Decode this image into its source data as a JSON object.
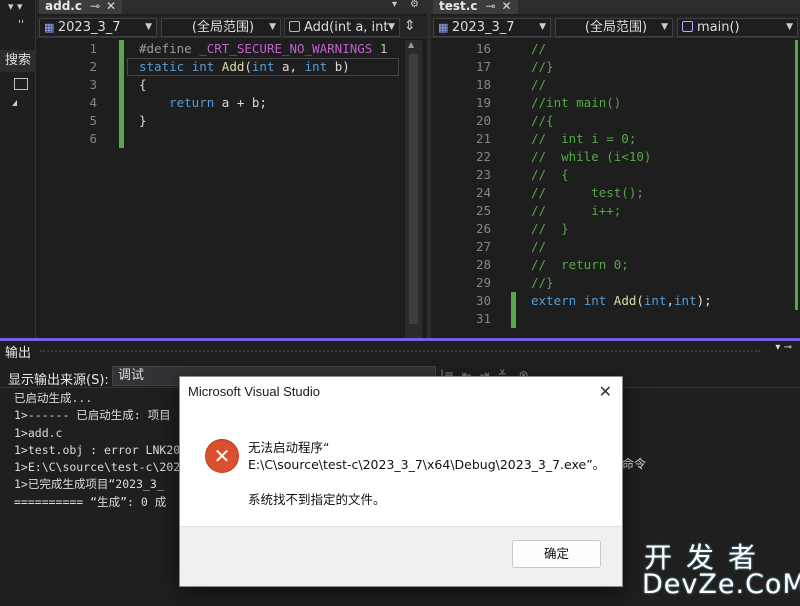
{
  "left_strip": {
    "search_label": "搜索",
    "pin": "▾ ▾",
    "more": "''"
  },
  "left_pane": {
    "tab": {
      "name": "add.c",
      "pin": "⊸",
      "close": "✕"
    },
    "more": "▾",
    "nav": {
      "project": "2023_3_7",
      "scope": "(全局范围)",
      "member": "Add(int a, int"
    },
    "lines": [
      {
        "n": "1",
        "html": "<span class=\"pp\">#define </span><span class=\"mac\">_CRT_SECURE_NO_WARNINGS</span><span class=\"pp\"> </span><span class=\"num\">1</span>"
      },
      {
        "n": "2",
        "html": "<span class=\"kw\">static</span> <span class=\"kw\">int</span> <span class=\"fn\">Add</span>(<span class=\"kw\">int</span> a, <span class=\"kw\">int</span> b)"
      },
      {
        "n": "3",
        "html": "{"
      },
      {
        "n": "4",
        "html": "    <span class=\"kw\">return</span> a + b;"
      },
      {
        "n": "5",
        "html": "}"
      },
      {
        "n": "6",
        "html": ""
      }
    ]
  },
  "right_pane": {
    "tab": {
      "name": "test.c",
      "pin": "⊸",
      "close": "✕"
    },
    "nav": {
      "project": "2023_3_7",
      "scope": "(全局范围)",
      "member": "main()"
    },
    "lines": [
      {
        "n": "16",
        "html": "<span class=\"cm\">//</span>"
      },
      {
        "n": "17",
        "html": "<span class=\"cm\">//}</span>"
      },
      {
        "n": "18",
        "html": "<span class=\"cm\">//</span>"
      },
      {
        "n": "19",
        "html": "<span class=\"cm\">//int main()</span>"
      },
      {
        "n": "20",
        "html": "<span class=\"cm\">//{</span>"
      },
      {
        "n": "21",
        "html": "<span class=\"cm\">//  int i = 0;</span>"
      },
      {
        "n": "22",
        "html": "<span class=\"cm\">//  while (i&lt;10)</span>"
      },
      {
        "n": "23",
        "html": "<span class=\"cm\">//  {</span>"
      },
      {
        "n": "24",
        "html": "<span class=\"cm\">//      test();</span>"
      },
      {
        "n": "25",
        "html": "<span class=\"cm\">//      i++;</span>"
      },
      {
        "n": "26",
        "html": "<span class=\"cm\">//  }</span>"
      },
      {
        "n": "27",
        "html": "<span class=\"cm\">//</span>"
      },
      {
        "n": "28",
        "html": "<span class=\"cm\">//  return 0;</span>"
      },
      {
        "n": "29",
        "html": "<span class=\"cm\">//}</span>"
      },
      {
        "n": "30",
        "html": "<span class=\"kw\">extern</span> <span class=\"kw\">int</span> <span class=\"fn\">Add</span>(<span class=\"kw\">int</span>,<span class=\"kw\">int</span>);"
      },
      {
        "n": "31",
        "html": ""
      }
    ]
  },
  "output": {
    "title": "输出",
    "controls": "▾ ⊸",
    "source_label": "显示输出来源(S):",
    "source_value": "调试",
    "toolbar_icons": "|≡  ⇤  ⇥  ≚   ⊗",
    "lines": [
      "已启动生成...",
      "1>------ 已启动生成: 项目",
      "1>add.c",
      "1>test.obj : error LNK2019",
      "1>E:\\C\\source\\test-c\\2023_",
      "1>已完成生成项目“2023_3_",
      "========== “生成”: 0 成"
    ],
    "right_fragment": "命令"
  },
  "dialog": {
    "title": "Microsoft Visual Studio",
    "close": "✕",
    "icon": "✕",
    "message_line1": "无法启动程序“",
    "message_line2": "E:\\C\\source\\test-c\\2023_3_7\\x64\\Debug\\2023_3_7.exe”。",
    "message_detail": "系统找不到指定的文件。",
    "ok_label": "确定"
  },
  "watermark": {
    "cn": "开发者",
    "en": "DevZe.CoM"
  }
}
